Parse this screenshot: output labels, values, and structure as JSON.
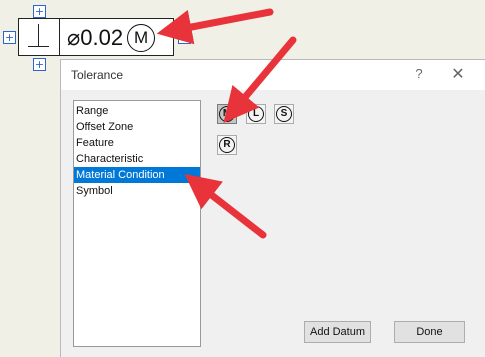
{
  "feature_control_frame": {
    "geometric_symbol": "perpendicularity",
    "tolerance_value": "⌀0.02",
    "material_modifier": "M"
  },
  "dialog": {
    "title": "Tolerance",
    "help_label": "?",
    "close_label": "✕",
    "categories": [
      {
        "label": "Range",
        "selected": false
      },
      {
        "label": "Offset Zone",
        "selected": false
      },
      {
        "label": "Feature",
        "selected": false
      },
      {
        "label": "Characteristic",
        "selected": false
      },
      {
        "label": "Material Condition",
        "selected": true
      },
      {
        "label": "Symbol",
        "selected": false
      }
    ],
    "modifiers": [
      {
        "letter": "M",
        "active": true
      },
      {
        "letter": "L",
        "active": false
      },
      {
        "letter": "S",
        "active": false
      },
      {
        "letter": "R",
        "active": false
      }
    ],
    "add_datum_label": "Add Datum",
    "done_label": "Done"
  },
  "colors": {
    "selection": "#0078d7",
    "annotation_arrow": "#e8333b",
    "handle_blue": "#2f64c9"
  }
}
